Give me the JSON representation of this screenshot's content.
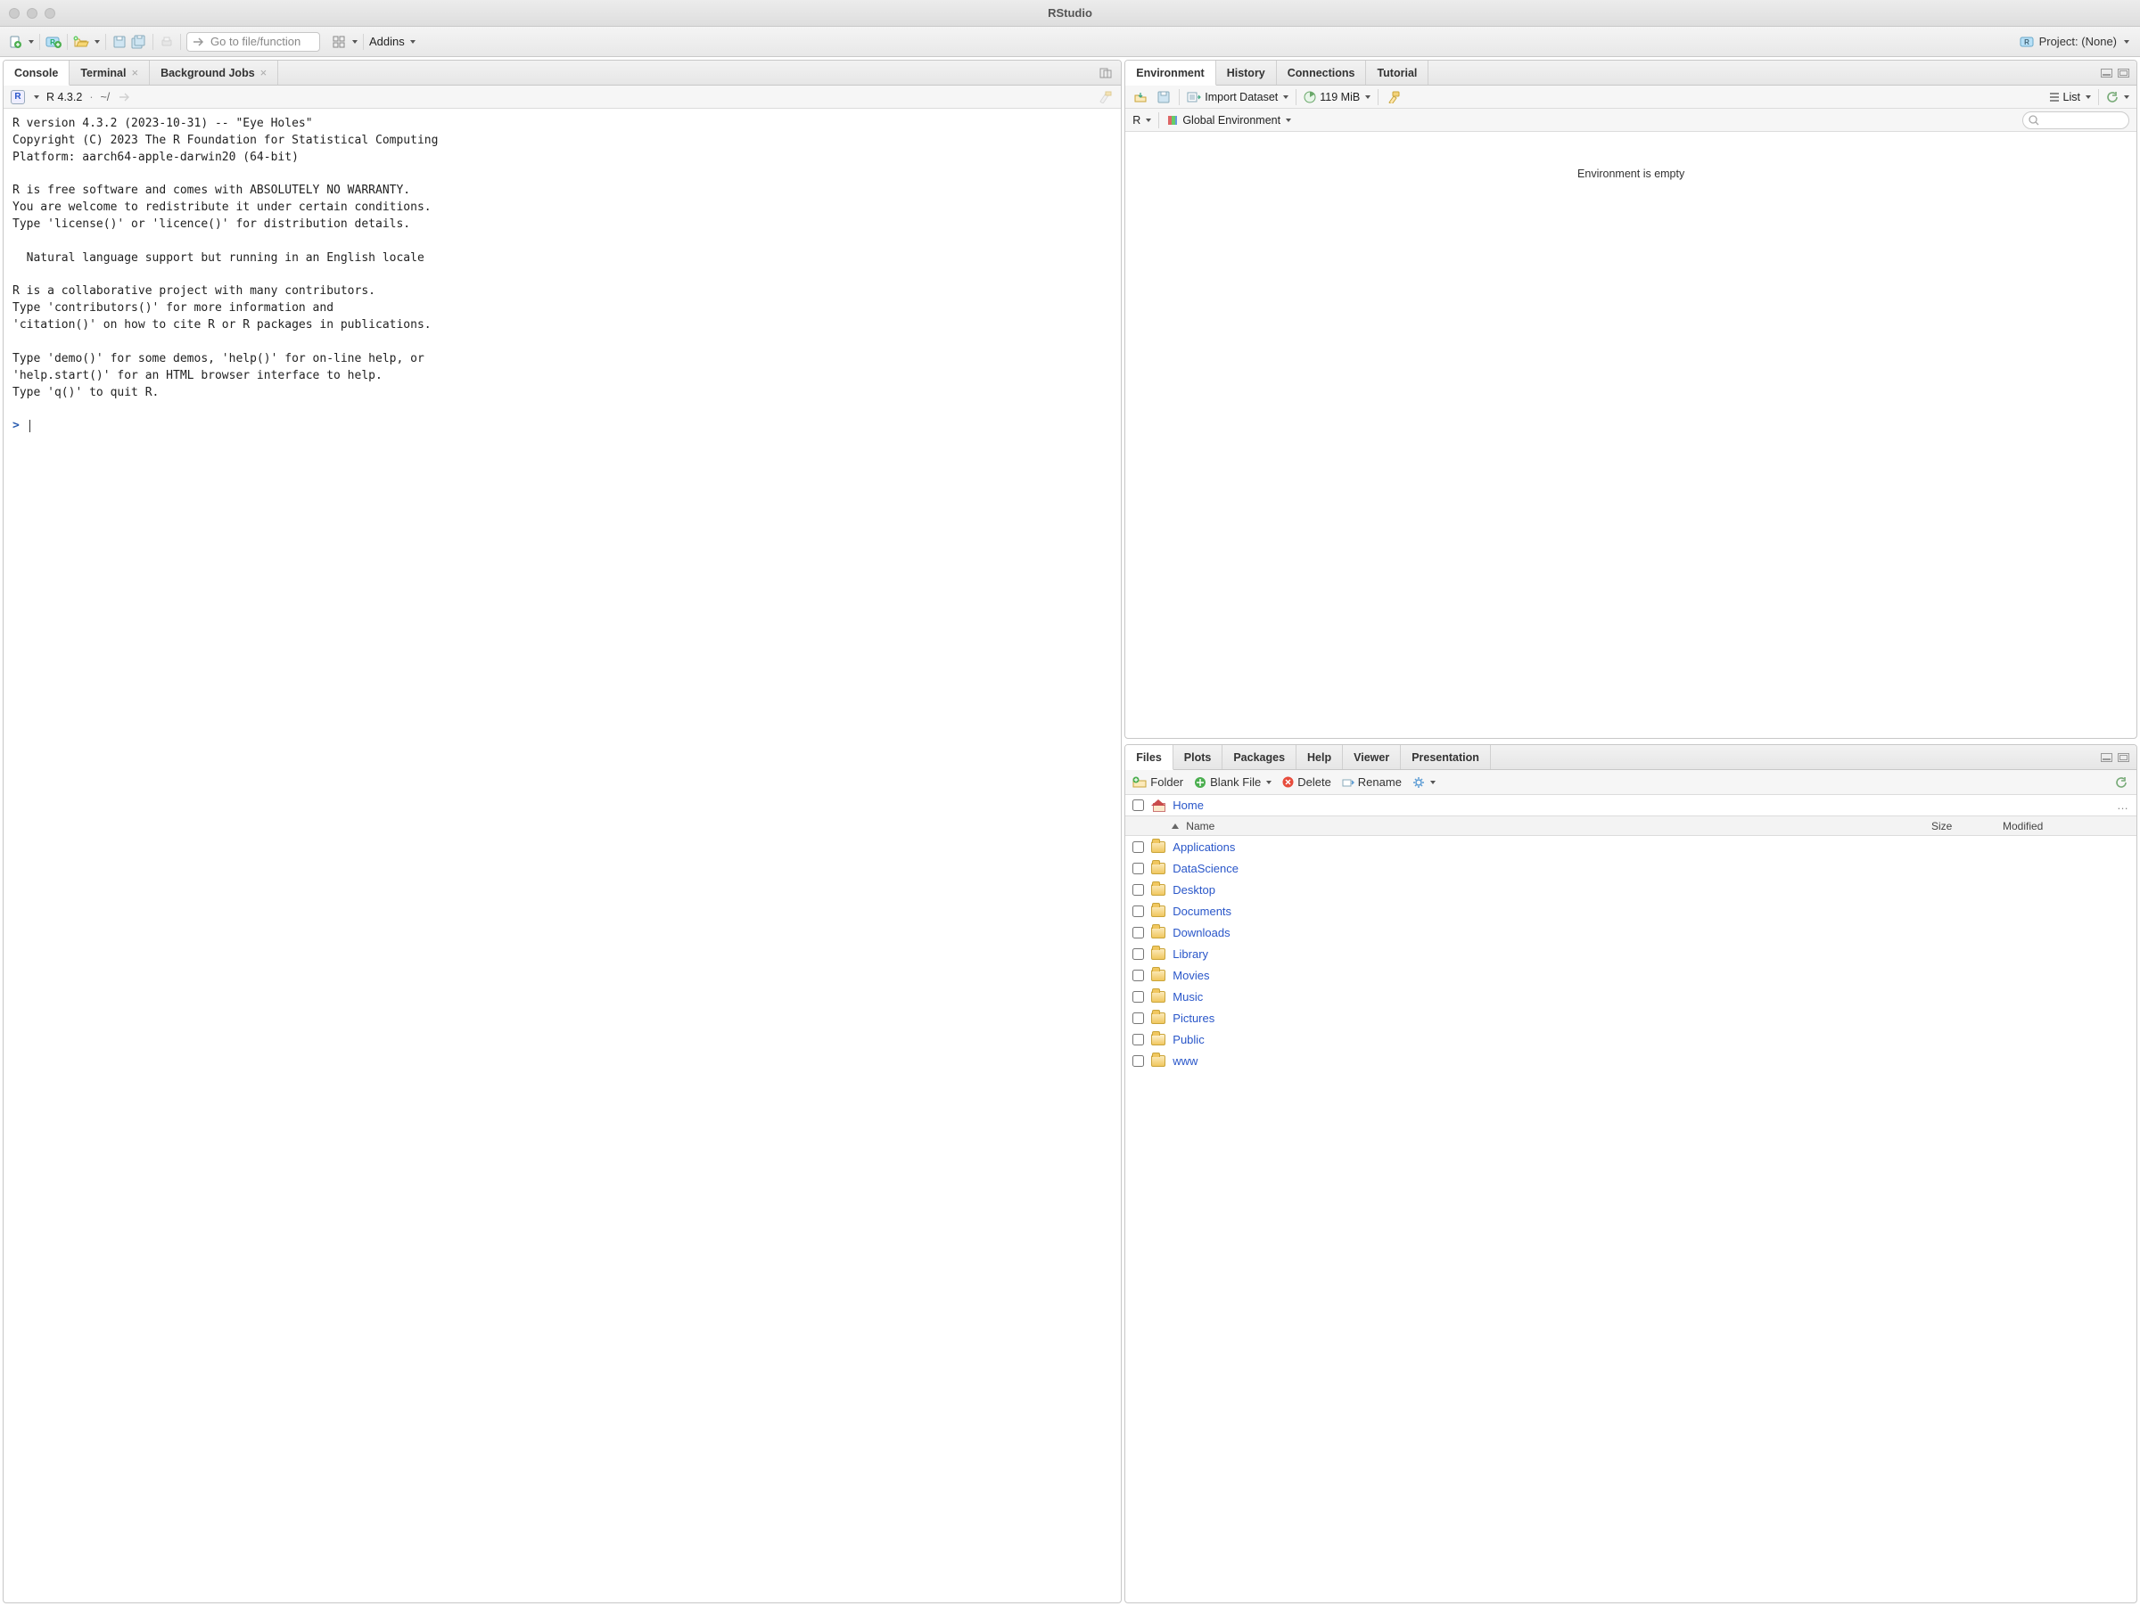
{
  "window": {
    "title": "RStudio"
  },
  "toolbar": {
    "goto_placeholder": "Go to file/function",
    "addins_label": "Addins",
    "project_label": "Project: (None)"
  },
  "left_tabs": {
    "console": "Console",
    "terminal": "Terminal",
    "bg_jobs": "Background Jobs"
  },
  "console": {
    "version_label": "R 4.3.2",
    "path_label": "~/",
    "dot": "·",
    "banner": "R version 4.3.2 (2023-10-31) -- \"Eye Holes\"\nCopyright (C) 2023 The R Foundation for Statistical Computing\nPlatform: aarch64-apple-darwin20 (64-bit)\n\nR is free software and comes with ABSOLUTELY NO WARRANTY.\nYou are welcome to redistribute it under certain conditions.\nType 'license()' or 'licence()' for distribution details.\n\n  Natural language support but running in an English locale\n\nR is a collaborative project with many contributors.\nType 'contributors()' for more information and\n'citation()' on how to cite R or R packages in publications.\n\nType 'demo()' for some demos, 'help()' for on-line help, or\n'help.start()' for an HTML browser interface to help.\nType 'q()' to quit R.\n",
    "prompt": ">"
  },
  "env_tabs": {
    "env": "Environment",
    "history": "History",
    "connections": "Connections",
    "tutorial": "Tutorial"
  },
  "env_bar": {
    "import_label": "Import Dataset",
    "memory": "119 MiB",
    "view_label": "List",
    "lang": "R",
    "scope": "Global Environment"
  },
  "env_body": {
    "empty": "Environment is empty"
  },
  "files_tabs": {
    "files": "Files",
    "plots": "Plots",
    "packages": "Packages",
    "help": "Help",
    "viewer": "Viewer",
    "presentation": "Presentation"
  },
  "files_bar": {
    "new_folder": "Folder",
    "new_blank": "Blank File",
    "delete": "Delete",
    "rename": "Rename"
  },
  "files_crumb": {
    "home": "Home"
  },
  "files_headers": {
    "name": "Name",
    "size": "Size",
    "modified": "Modified"
  },
  "files_list": [
    {
      "name": "Applications",
      "public": false
    },
    {
      "name": "DataScience",
      "public": false
    },
    {
      "name": "Desktop",
      "public": false
    },
    {
      "name": "Documents",
      "public": false
    },
    {
      "name": "Downloads",
      "public": false
    },
    {
      "name": "Library",
      "public": false
    },
    {
      "name": "Movies",
      "public": false
    },
    {
      "name": "Music",
      "public": false
    },
    {
      "name": "Pictures",
      "public": false
    },
    {
      "name": "Public",
      "public": true
    },
    {
      "name": "www",
      "public": false
    }
  ]
}
